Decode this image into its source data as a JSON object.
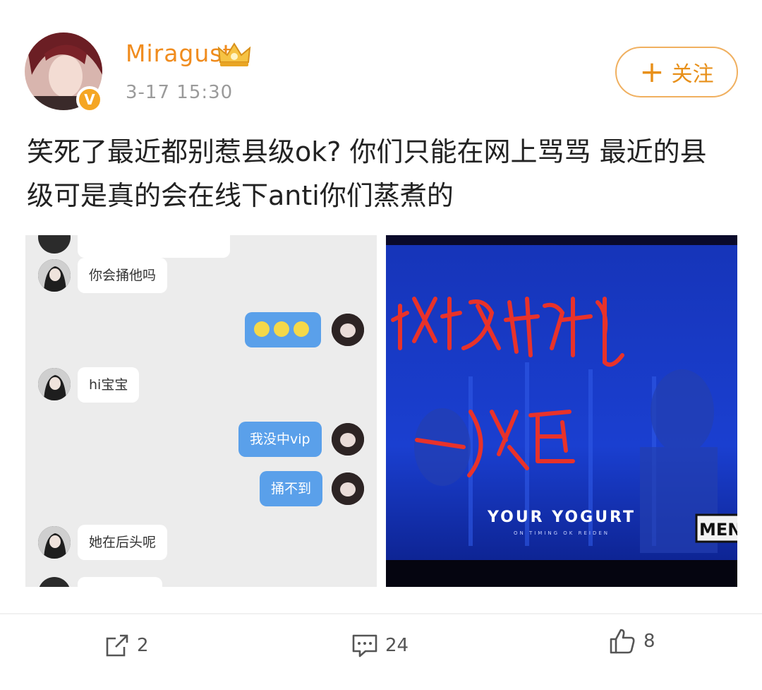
{
  "user": {
    "name": "Miragust",
    "time": "3-17 15:30",
    "verified_mark": "V"
  },
  "follow": {
    "plus": "+",
    "label": "关注"
  },
  "post": {
    "text": "笑死了最近都别惹县级ok? 你们只能在网上骂骂 最近的县级可是真的会在线下anti你们蒸煮的"
  },
  "chat": {
    "messages": [
      {
        "side": "in",
        "text": "你会捅他吗"
      },
      {
        "side": "out",
        "text": ""
      },
      {
        "side": "in",
        "text": "hi宝宝"
      },
      {
        "side": "out",
        "text": "我没中vip"
      },
      {
        "side": "out",
        "text": "捅不到"
      },
      {
        "side": "in",
        "text": "她在后头呢"
      }
    ]
  },
  "photo": {
    "handwriting_line1": "米格斯特",
    "handwriting_line2": "一)火E",
    "screen_title": "YOUR YOGURT",
    "screen_sub": "ON  TIMING  OK  REIDEN",
    "badge": "MEN"
  },
  "actions": {
    "repost_count": "2",
    "comment_count": "24",
    "like_count": "8"
  },
  "colors": {
    "accent": "#f08c1e",
    "bubble_out": "#5aa0ea",
    "screen_bg": "#0a1a8c",
    "ink": "#e8322a"
  }
}
